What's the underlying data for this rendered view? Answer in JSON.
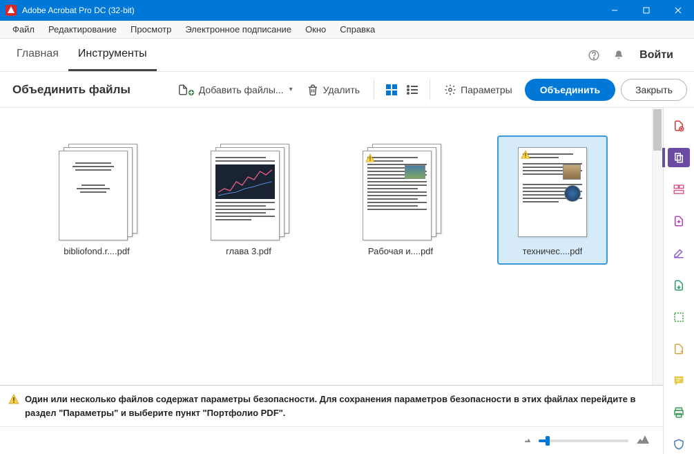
{
  "titlebar": {
    "title": "Adobe Acrobat Pro DC (32-bit)"
  },
  "menubar": [
    "Файл",
    "Редактирование",
    "Просмотр",
    "Электронное подписание",
    "Окно",
    "Справка"
  ],
  "tabs": {
    "home": "Главная",
    "tools": "Инструменты",
    "signin": "Войти"
  },
  "toolbar": {
    "title": "Объединить файлы",
    "add_files": "Добавить файлы...",
    "delete": "Удалить",
    "options": "Параметры",
    "combine": "Объединить",
    "close": "Закрыть"
  },
  "files": [
    {
      "name": "bibliofond.r....pdf",
      "multi": true,
      "warn": false,
      "kind": "text"
    },
    {
      "name": "глава 3.pdf",
      "multi": true,
      "warn": false,
      "kind": "chart"
    },
    {
      "name": "Рабочая и....pdf",
      "multi": true,
      "warn": true,
      "kind": "doc-img"
    },
    {
      "name": "техничес....pdf",
      "multi": false,
      "warn": true,
      "kind": "doc-img2",
      "selected": true
    }
  ],
  "banner": {
    "text": "Один или несколько файлов содержат параметры безопасности. Для сохранения параметров безопасности в этих файлах перейдите в раздел \"Параметры\" и выберите пункт \"Портфолио PDF\"."
  },
  "colors": {
    "accent": "#0078d7",
    "rail_active": "#6b4ba3"
  }
}
